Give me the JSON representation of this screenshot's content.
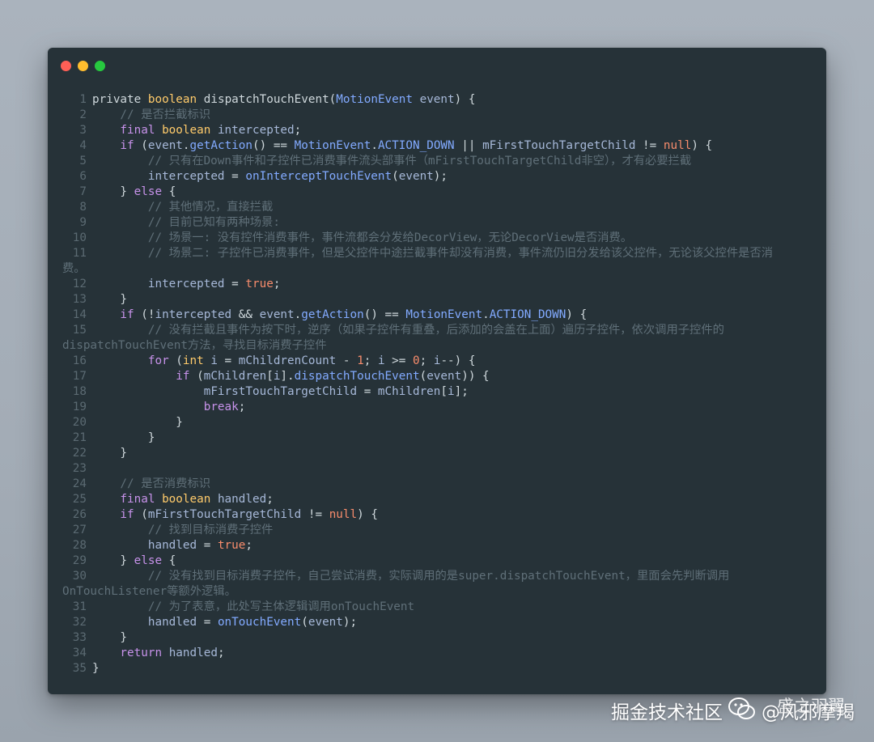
{
  "colors": {
    "page_bg": "#a3acb6",
    "editor_bg": "#263238",
    "dot_close": "#ff5f56",
    "dot_minimize": "#ffbd2e",
    "dot_maximize": "#27c93f",
    "keyword": "#c792ea",
    "type": "#ffcb6b",
    "function": "#82aaff",
    "literal": "#f78c6c",
    "comment": "#5f6f78"
  },
  "window_controls": [
    "close-dot",
    "minimize-dot",
    "maximize-dot"
  ],
  "code": [
    {
      "n": "1",
      "tokens": [
        [
          "pl",
          "private "
        ],
        [
          "ty",
          "boolean "
        ],
        [
          "pl",
          "dispatchTouchEvent("
        ],
        [
          "cls",
          "MotionEvent"
        ],
        [
          "id",
          " event"
        ],
        [
          "pl",
          ") {"
        ]
      ]
    },
    {
      "n": "2",
      "tokens": [
        [
          "c",
          "    // 是否拦截标识"
        ]
      ]
    },
    {
      "n": "3",
      "tokens": [
        [
          "kw",
          "    final "
        ],
        [
          "ty",
          "boolean "
        ],
        [
          "id",
          "intercepted"
        ],
        [
          "pl",
          ";"
        ]
      ]
    },
    {
      "n": "4",
      "tokens": [
        [
          "kw",
          "    if "
        ],
        [
          "pl",
          "("
        ],
        [
          "id",
          "event"
        ],
        [
          "pl",
          "."
        ],
        [
          "fn",
          "getAction"
        ],
        [
          "pl",
          "() == "
        ],
        [
          "cls",
          "MotionEvent"
        ],
        [
          "pl",
          "."
        ],
        [
          "cls",
          "ACTION_DOWN"
        ],
        [
          "pl",
          " || "
        ],
        [
          "id",
          "mFirstTouchTargetChild"
        ],
        [
          "pl",
          " != "
        ],
        [
          "lit",
          "null"
        ],
        [
          "pl",
          ") {"
        ]
      ]
    },
    {
      "n": "5",
      "tokens": [
        [
          "c",
          "        // 只有在Down事件和子控件已消费事件流头部事件（mFirstTouchTargetChild非空），才有必要拦截"
        ]
      ]
    },
    {
      "n": "6",
      "tokens": [
        [
          "id",
          "        intercepted"
        ],
        [
          "pl",
          " = "
        ],
        [
          "fn",
          "onInterceptTouchEvent"
        ],
        [
          "pl",
          "("
        ],
        [
          "id",
          "event"
        ],
        [
          "pl",
          ");"
        ]
      ]
    },
    {
      "n": "7",
      "tokens": [
        [
          "pl",
          "    } "
        ],
        [
          "kw",
          "else"
        ],
        [
          "pl",
          " {"
        ]
      ]
    },
    {
      "n": "8",
      "tokens": [
        [
          "c",
          "        // 其他情况，直接拦截"
        ]
      ]
    },
    {
      "n": "9",
      "tokens": [
        [
          "c",
          "        // 目前已知有两种场景:"
        ]
      ]
    },
    {
      "n": "10",
      "tokens": [
        [
          "c",
          "        // 场景一: 没有控件消费事件，事件流都会分发给DecorView，无论DecorView是否消费。"
        ]
      ]
    },
    {
      "n": "11",
      "tokens": [
        [
          "c",
          "        // 场景二: 子控件已消费事件，但是父控件中途拦截事件却没有消费，事件流仍旧分发给该父控件，无论该父控件是否消"
        ]
      ],
      "cont": "费。"
    },
    {
      "n": "12",
      "tokens": [
        [
          "id",
          "        intercepted"
        ],
        [
          "pl",
          " = "
        ],
        [
          "lit",
          "true"
        ],
        [
          "pl",
          ";"
        ]
      ]
    },
    {
      "n": "13",
      "tokens": [
        [
          "pl",
          "    }"
        ]
      ]
    },
    {
      "n": "14",
      "tokens": [
        [
          "kw",
          "    if "
        ],
        [
          "pl",
          "(!"
        ],
        [
          "id",
          "intercepted"
        ],
        [
          "pl",
          " && "
        ],
        [
          "id",
          "event"
        ],
        [
          "pl",
          "."
        ],
        [
          "fn",
          "getAction"
        ],
        [
          "pl",
          "() == "
        ],
        [
          "cls",
          "MotionEvent"
        ],
        [
          "pl",
          "."
        ],
        [
          "cls",
          "ACTION_DOWN"
        ],
        [
          "pl",
          ") {"
        ]
      ]
    },
    {
      "n": "15",
      "tokens": [
        [
          "c",
          "        // 没有拦截且事件为按下时，逆序（如果子控件有重叠，后添加的会盖在上面）遍历子控件，依次调用子控件的"
        ]
      ],
      "cont": "dispatchTouchEvent方法，寻找目标消费子控件"
    },
    {
      "n": "16",
      "tokens": [
        [
          "kw",
          "        for "
        ],
        [
          "pl",
          "("
        ],
        [
          "ty",
          "int "
        ],
        [
          "id",
          "i"
        ],
        [
          "pl",
          " = "
        ],
        [
          "id",
          "mChildrenCount"
        ],
        [
          "pl",
          " - "
        ],
        [
          "lit",
          "1"
        ],
        [
          "pl",
          "; "
        ],
        [
          "id",
          "i"
        ],
        [
          "pl",
          " >= "
        ],
        [
          "lit",
          "0"
        ],
        [
          "pl",
          "; "
        ],
        [
          "id",
          "i"
        ],
        [
          "pl",
          "--) {"
        ]
      ]
    },
    {
      "n": "17",
      "tokens": [
        [
          "kw",
          "            if "
        ],
        [
          "pl",
          "("
        ],
        [
          "id",
          "mChildren"
        ],
        [
          "pl",
          "["
        ],
        [
          "id",
          "i"
        ],
        [
          "pl",
          "]."
        ],
        [
          "fn",
          "dispatchTouchEvent"
        ],
        [
          "pl",
          "("
        ],
        [
          "id",
          "event"
        ],
        [
          "pl",
          ")) {"
        ]
      ]
    },
    {
      "n": "18",
      "tokens": [
        [
          "id",
          "                mFirstTouchTargetChild"
        ],
        [
          "pl",
          " = "
        ],
        [
          "id",
          "mChildren"
        ],
        [
          "pl",
          "["
        ],
        [
          "id",
          "i"
        ],
        [
          "pl",
          "];"
        ]
      ]
    },
    {
      "n": "19",
      "tokens": [
        [
          "kw",
          "                break"
        ],
        [
          "pl",
          ";"
        ]
      ]
    },
    {
      "n": "20",
      "tokens": [
        [
          "pl",
          "            }"
        ]
      ]
    },
    {
      "n": "21",
      "tokens": [
        [
          "pl",
          "        }"
        ]
      ]
    },
    {
      "n": "22",
      "tokens": [
        [
          "pl",
          "    }"
        ]
      ]
    },
    {
      "n": "23",
      "tokens": [
        [
          "pl",
          ""
        ]
      ]
    },
    {
      "n": "24",
      "tokens": [
        [
          "c",
          "    // 是否消费标识"
        ]
      ]
    },
    {
      "n": "25",
      "tokens": [
        [
          "kw",
          "    final "
        ],
        [
          "ty",
          "boolean "
        ],
        [
          "id",
          "handled"
        ],
        [
          "pl",
          ";"
        ]
      ]
    },
    {
      "n": "26",
      "tokens": [
        [
          "kw",
          "    if "
        ],
        [
          "pl",
          "("
        ],
        [
          "id",
          "mFirstTouchTargetChild"
        ],
        [
          "pl",
          " != "
        ],
        [
          "lit",
          "null"
        ],
        [
          "pl",
          ") {"
        ]
      ]
    },
    {
      "n": "27",
      "tokens": [
        [
          "c",
          "        // 找到目标消费子控件"
        ]
      ]
    },
    {
      "n": "28",
      "tokens": [
        [
          "id",
          "        handled"
        ],
        [
          "pl",
          " = "
        ],
        [
          "lit",
          "true"
        ],
        [
          "pl",
          ";"
        ]
      ]
    },
    {
      "n": "29",
      "tokens": [
        [
          "pl",
          "    } "
        ],
        [
          "kw",
          "else"
        ],
        [
          "pl",
          " {"
        ]
      ]
    },
    {
      "n": "30",
      "tokens": [
        [
          "c",
          "        // 没有找到目标消费子控件，自己尝试消费，实际调用的是super.dispatchTouchEvent，里面会先判断调用"
        ]
      ],
      "cont": "OnTouchListener等额外逻辑。"
    },
    {
      "n": "31",
      "tokens": [
        [
          "c",
          "        // 为了表意，此处写主体逻辑调用onTouchEvent"
        ]
      ]
    },
    {
      "n": "32",
      "tokens": [
        [
          "id",
          "        handled"
        ],
        [
          "pl",
          " = "
        ],
        [
          "fn",
          "onTouchEvent"
        ],
        [
          "pl",
          "("
        ],
        [
          "id",
          "event"
        ],
        [
          "pl",
          ");"
        ]
      ]
    },
    {
      "n": "33",
      "tokens": [
        [
          "pl",
          "    }"
        ]
      ]
    },
    {
      "n": "34",
      "tokens": [
        [
          "kw",
          "    return "
        ],
        [
          "id",
          "handled"
        ],
        [
          "pl",
          ";"
        ]
      ]
    },
    {
      "n": "35",
      "tokens": [
        [
          "pl",
          "}"
        ]
      ]
    }
  ],
  "watermark": {
    "site": "掘金技术社区",
    "handle": "@风邪摩羯",
    "account_name": "盛之羽翼",
    "icon": "wechat-icon"
  }
}
